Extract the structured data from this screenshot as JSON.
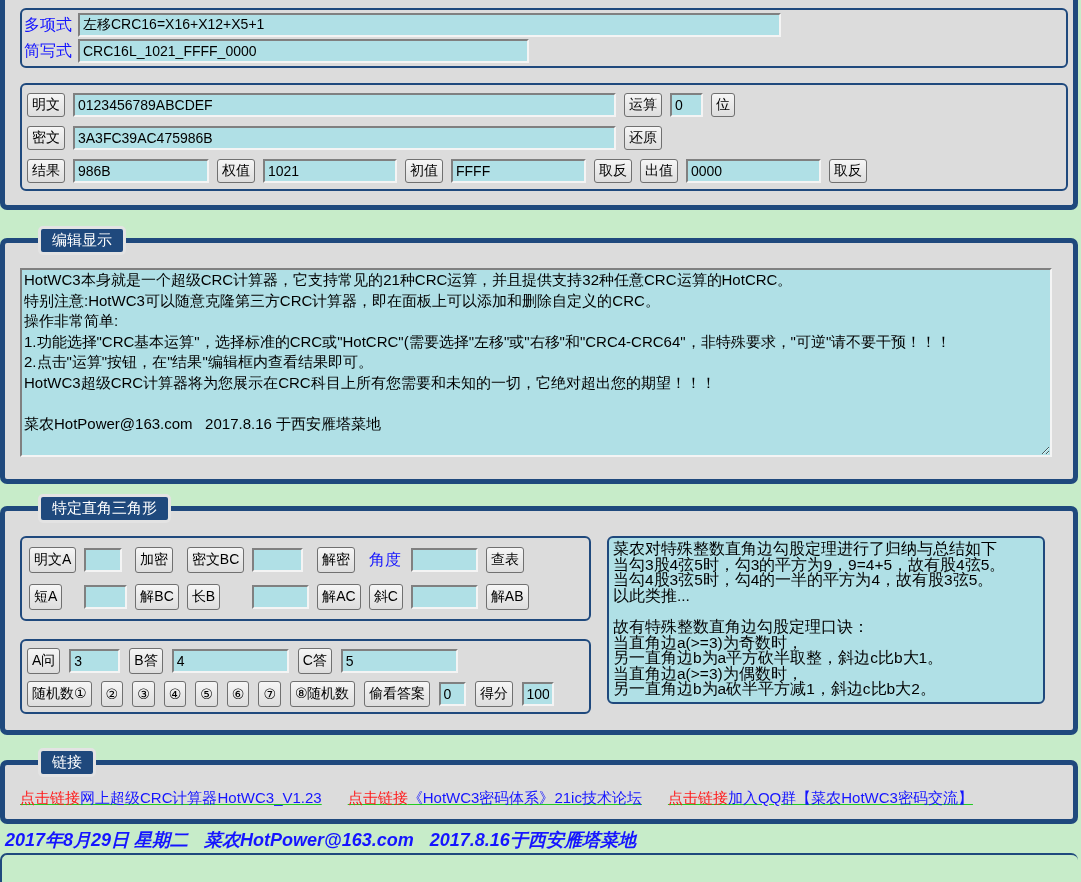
{
  "formula_box": {
    "rows": [
      {
        "label": "多项式",
        "value": "左移CRC16=X16+X12+X5+1"
      },
      {
        "label": "简写式",
        "value": "CRC16L_1021_FFFF_0000"
      }
    ]
  },
  "crc_box": {
    "rows": [
      [
        {
          "kind": "button",
          "text": "明文"
        },
        {
          "kind": "field",
          "value": "0123456789ABCDEF"
        },
        {
          "kind": "button",
          "text": "运算"
        },
        {
          "kind": "field",
          "value": "0"
        },
        {
          "kind": "button",
          "text": "位"
        }
      ],
      [
        {
          "kind": "button",
          "text": "密文"
        },
        {
          "kind": "field",
          "value": "3A3FC39AC475986B"
        },
        {
          "kind": "button",
          "text": "还原"
        }
      ],
      [
        {
          "kind": "button",
          "text": "结果"
        },
        {
          "kind": "field",
          "value": "986B"
        },
        {
          "kind": "button",
          "text": "权值"
        },
        {
          "kind": "field",
          "value": "1021"
        },
        {
          "kind": "button",
          "text": "初值"
        },
        {
          "kind": "field",
          "value": "FFFF"
        },
        {
          "kind": "button",
          "text": "取反"
        },
        {
          "kind": "button",
          "text": "出值"
        },
        {
          "kind": "field",
          "value": "0000"
        },
        {
          "kind": "button",
          "text": "取反"
        }
      ]
    ]
  },
  "edit_panel": {
    "title": "编辑显示",
    "text_blocks": [
      [
        "HotWC3本身就是一个超级CRC计算器，它支持常见的21种CRC运算，并且提供支持32种任意CRC运算的HotCRC。",
        "特别注意:HotWC3可以随意克隆第三方CRC计算器，即在面板上可以添加和删除自定义的CRC。",
        "操作非常简单:",
        "1.功能选择\"CRC基本运算\"，选择标准的CRC或\"HotCRC\"(需要选择\"左移\"或\"右移\"和\"CRC4-CRC64\"，非特殊要求，\"可逆\"请不要干预！！！",
        "2.点击\"运算\"按钮，在\"结果\"编辑框内查看结果即可。",
        "HotWC3超级CRC计算器将为您展示在CRC科目上所有您需要和未知的一切，它绝对超出您的期望！！！"
      ],
      [
        "菜农HotPower@163.com   2017.8.16 于西安雁塔菜地"
      ]
    ]
  },
  "triangle_panel": {
    "title": "特定直角三角形",
    "cipher_rows": [
      [
        {
          "kind": "button",
          "text": "明文A"
        },
        {
          "kind": "field"
        },
        {
          "kind": "button",
          "text": "加密"
        },
        {
          "kind": "button",
          "text": "密文BC"
        },
        {
          "kind": "field"
        },
        {
          "kind": "button",
          "text": "解密"
        },
        {
          "kind": "label",
          "text": "角度"
        },
        {
          "kind": "field"
        },
        {
          "kind": "button",
          "text": "查表"
        }
      ],
      [
        {
          "kind": "button",
          "text": "短A"
        },
        {
          "kind": "field"
        },
        {
          "kind": "button",
          "text": "解BC"
        },
        {
          "kind": "button",
          "text": "长B"
        },
        {
          "kind": "field"
        },
        {
          "kind": "button",
          "text": "解AC"
        },
        {
          "kind": "button",
          "text": "斜C"
        },
        {
          "kind": "field"
        },
        {
          "kind": "button",
          "text": "解AB"
        }
      ]
    ],
    "quiz_rows": [
      [
        {
          "kind": "button",
          "text": "A问"
        },
        {
          "kind": "field",
          "value": "3"
        },
        {
          "kind": "button",
          "text": "B答"
        },
        {
          "kind": "field",
          "value": "4"
        },
        {
          "kind": "button",
          "text": "C答"
        },
        {
          "kind": "field",
          "value": "5"
        }
      ],
      [
        {
          "kind": "button",
          "text": "随机数①"
        },
        {
          "kind": "button",
          "text": "②"
        },
        {
          "kind": "button",
          "text": "③"
        },
        {
          "kind": "button",
          "text": "④"
        },
        {
          "kind": "button",
          "text": "⑤"
        },
        {
          "kind": "button",
          "text": "⑥"
        },
        {
          "kind": "button",
          "text": "⑦"
        },
        {
          "kind": "button",
          "text": "⑧随机数"
        },
        {
          "kind": "button",
          "text": "偷看答案"
        },
        {
          "kind": "field",
          "value": "0"
        },
        {
          "kind": "button",
          "text": "得分"
        },
        {
          "kind": "field",
          "value": "100"
        }
      ]
    ],
    "note_blocks": [
      [
        "菜农对特殊整数直角边勾股定理进行了归纳与总结如下",
        "当勾3股4弦5时，勾3的平方为9，9=4+5，故有股4弦5。",
        "当勾4股3弦5时，勾4的一半的平方为4，故有股3弦5。",
        "以此类推..."
      ],
      [
        "故有特殊整数直角边勾股定理口诀：",
        "当直角边a(>=3)为奇数时，",
        "另一直角边b为a平方砍半取整，斜边c比b大1。",
        "当直角边a(>=3)为偶数时，",
        "另一直角边b为a砍半平方减1，斜边c比b大2。"
      ]
    ]
  },
  "links_panel": {
    "title": "链接",
    "links": [
      {
        "prefix": "点击链接",
        "text": "网上超级CRC计算器HotWC3_V1.23"
      },
      {
        "prefix": "点击链接",
        "text": "《HotWC3密码体系》21ic技术论坛"
      },
      {
        "prefix": "点击链接",
        "text": "加入QQ群【菜农HotWC3密码交流】"
      }
    ]
  },
  "footer": [
    "2017年8月29日 星期二",
    "菜农HotPower@163.com",
    "2017.8.16于西安雁塔菜地"
  ]
}
